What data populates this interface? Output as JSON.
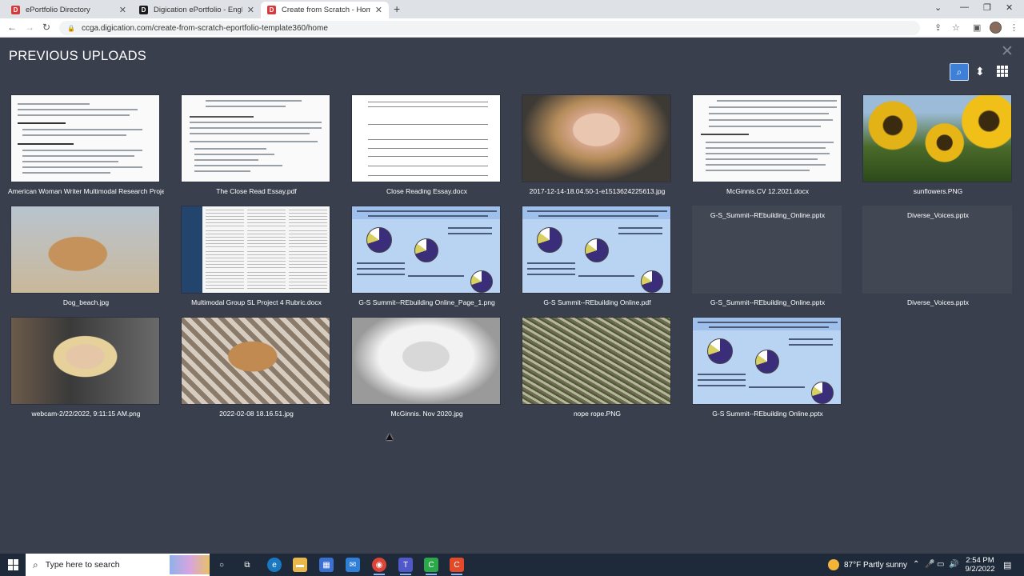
{
  "browser": {
    "tabs": [
      {
        "title": "ePortfolio Directory",
        "favicon": "D",
        "color": "#d9383a"
      },
      {
        "title": "Digication ePortfolio - English Co",
        "favicon": "D",
        "color": "#1a1a1a"
      },
      {
        "title": "Create from Scratch - Home",
        "favicon": "D",
        "color": "#d9383a"
      }
    ],
    "new_tab": "+",
    "url": "ccga.digication.com/create-from-scratch-eportfolio-template360/home"
  },
  "modal": {
    "title": "PREVIOUS UPLOADS",
    "close": "✕",
    "files": [
      {
        "name": "American Woman Writer Multimodal Research Proje..."
      },
      {
        "name": "The Close Read Essay.pdf"
      },
      {
        "name": "Close Reading Essay.docx"
      },
      {
        "name": "2017-12-14-18.04.50-1-e1513624225613.jpg"
      },
      {
        "name": "McGinnis.CV 12.2021.docx"
      },
      {
        "name": "sunflowers.PNG"
      },
      {
        "name": "Dog_beach.jpg"
      },
      {
        "name": "Multimodal Group SL Project 4 Rubric.docx"
      },
      {
        "name": "G-S Summit--REbuilding Online_Page_1.png"
      },
      {
        "name": "G-S Summit--REbuilding Online.pdf"
      },
      {
        "name": "G-S_Summit--REbuilding_Online.pptx",
        "broken_label": "G-S_Summit--REbuilding_Online.pptx"
      },
      {
        "name": "Diverse_Voices.pptx",
        "broken_label": "Diverse_Voices.pptx"
      },
      {
        "name": "webcam-2/22/2022, 9:11:15 AM.png"
      },
      {
        "name": "2022-02-08 18.16.51.jpg"
      },
      {
        "name": "McGinnis. Nov 2020.jpg"
      },
      {
        "name": "nope rope.PNG"
      },
      {
        "name": "G-S Summit--REbuilding Online.pptx"
      }
    ]
  },
  "taskbar": {
    "search_placeholder": "Type here to search",
    "weather": "87°F  Partly sunny",
    "time": "2:54 PM",
    "date": "9/2/2022"
  }
}
